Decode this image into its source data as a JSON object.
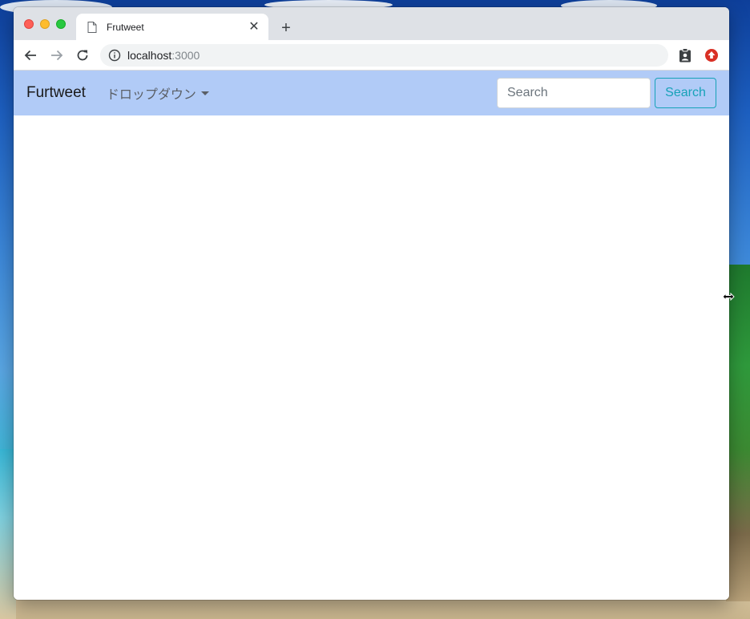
{
  "browser": {
    "tab": {
      "title": "Frutweet",
      "close_glyph": "✕"
    },
    "new_tab_glyph": "+",
    "address": {
      "host": "localhost",
      "port": ":3000"
    },
    "icons": {
      "tab": "page-icon",
      "back": "arrow-left-icon",
      "forward": "arrow-right-icon",
      "reload": "reload-icon",
      "info": "info-icon",
      "extension_1": "clipboard-user-icon",
      "extension_2": "upload-arrow-icon"
    },
    "colors": {
      "traffic_red": "#fe5f57",
      "traffic_yellow": "#febc2e",
      "traffic_green": "#28c840",
      "extension_2": "#d93025"
    }
  },
  "navbar": {
    "brand": "Furtweet",
    "dropdown_label": "ドロップダウン",
    "search": {
      "placeholder": "Search",
      "value": "",
      "button_label": "Search"
    },
    "colors": {
      "background": "#b1cbf7",
      "button_outline": "#17a2b8"
    }
  },
  "cursor": {
    "icon": "resize-horizontal-cursor-icon"
  }
}
